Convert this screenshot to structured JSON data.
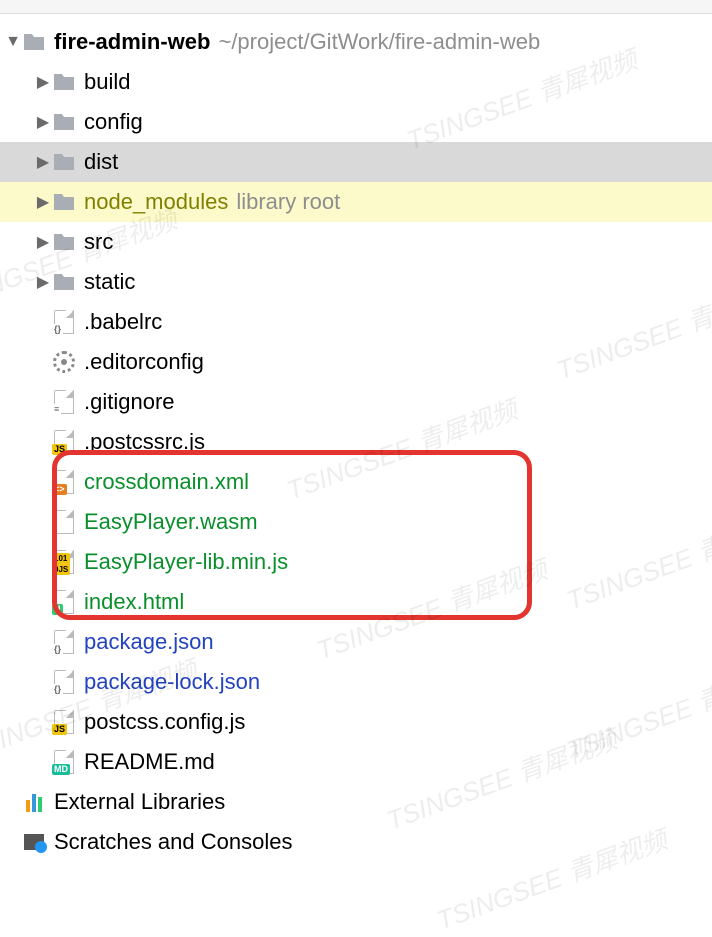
{
  "root": {
    "name": "fire-admin-web",
    "path": "~/project/GitWork/fire-admin-web"
  },
  "folders": {
    "build": "build",
    "config": "config",
    "dist": "dist",
    "node_modules": "node_modules",
    "node_modules_hint": "library root",
    "src": "src",
    "static": "static"
  },
  "files": {
    "babelrc": ".babelrc",
    "editorconfig": ".editorconfig",
    "gitignore": ".gitignore",
    "postcssrc": ".postcssrc.js",
    "crossdomain": "crossdomain.xml",
    "easyplayer_wasm": "EasyPlayer.wasm",
    "easyplayer_lib": "EasyPlayer-lib.min.js",
    "index_html": "index.html",
    "package_json": "package.json",
    "package_lock": "package-lock.json",
    "postcss_config": "postcss.config.js",
    "readme": "README.md"
  },
  "bottom": {
    "external_libs": "External Libraries",
    "scratches": "Scratches and Consoles"
  },
  "watermark": "TSINGSEE 青犀视频"
}
